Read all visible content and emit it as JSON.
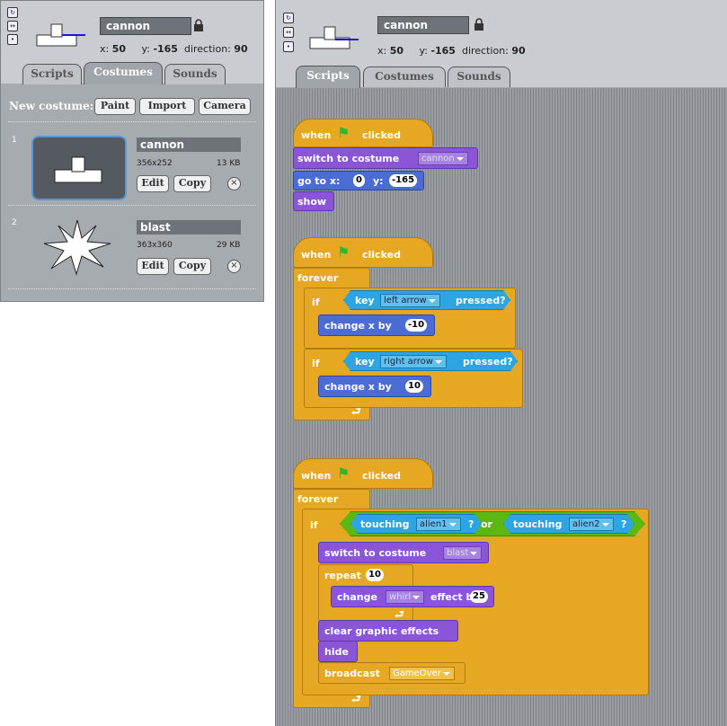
{
  "left": {
    "sprite_name": "cannon",
    "x_label": "x:",
    "x_value": "50",
    "y_label": "y:",
    "y_value": "-165",
    "direction_label": "direction:",
    "direction_value": "90",
    "tabs": [
      "Scripts",
      "Costumes",
      "Sounds"
    ],
    "active_tab": "Costumes",
    "new_costume_label": "New costume:",
    "buttons": [
      "Paint",
      "Import",
      "Camera"
    ],
    "costumes": [
      {
        "index": "1",
        "name": "cannon",
        "size": "356x252",
        "filesize": "13 KB",
        "edit": "Edit",
        "copy": "Copy"
      },
      {
        "index": "2",
        "name": "blast",
        "size": "363x360",
        "filesize": "29 KB",
        "edit": "Edit",
        "copy": "Copy"
      }
    ]
  },
  "right": {
    "sprite_name": "cannon",
    "x_label": "x:",
    "x_value": "50",
    "y_label": "y:",
    "y_value": "-165",
    "direction_label": "direction:",
    "direction_value": "90",
    "tabs": [
      "Scripts",
      "Costumes",
      "Sounds"
    ],
    "active_tab": "Scripts"
  },
  "scripts": {
    "s1": {
      "when": "when",
      "clicked": "clicked",
      "switch": "switch to costume",
      "costume": "cannon",
      "goto": "go to x:",
      "x": "0",
      "y_label": "y:",
      "y": "-165",
      "show": "show"
    },
    "s2": {
      "when": "when",
      "clicked": "clicked",
      "forever": "forever",
      "if1": "if",
      "key1": "key",
      "key1_value": "left arrow",
      "pressed1": "pressed?",
      "change1": "change x by",
      "change1_value": "-10",
      "if2": "if",
      "key2": "key",
      "key2_value": "right arrow",
      "pressed2": "pressed?",
      "change2": "change x by",
      "change2_value": "10"
    },
    "s3": {
      "when": "when",
      "clicked": "clicked",
      "forever": "forever",
      "if": "if",
      "touching1": "touching",
      "touching1_value": "alien1",
      "q1": "?",
      "or": "or",
      "touching2": "touching",
      "touching2_value": "alien2",
      "q2": "?",
      "switch": "switch to costume",
      "costume": "blast",
      "repeat": "repeat",
      "repeat_value": "10",
      "change": "change",
      "effect": "whirl",
      "effect_by": "effect by",
      "effect_value": "25",
      "clear": "clear graphic effects",
      "hide": "hide",
      "broadcast": "broadcast",
      "message": "GameOver"
    }
  }
}
